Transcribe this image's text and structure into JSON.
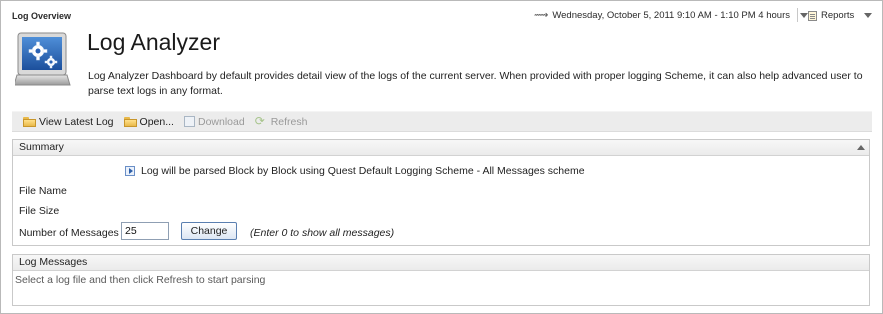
{
  "header": {
    "view_title": "Log Overview",
    "time_range": "Wednesday, October 5, 2011 9:10 AM - 1:10 PM 4 hours",
    "reports_label": "Reports"
  },
  "app": {
    "icon": "gear-monitor-icon",
    "title": "Log Analyzer",
    "description": "Log Analyzer Dashboard by default provides detail view of the logs of the current server. When provided with proper logging Scheme, it can also help advanced user to parse text logs in any format."
  },
  "toolbar": {
    "view_latest": "View Latest Log",
    "open": "Open...",
    "download": "Download",
    "refresh": "Refresh"
  },
  "summary": {
    "title": "Summary",
    "scheme_text": "Log will be parsed Block by Block using Quest Default Logging Scheme - All Messages scheme",
    "file_name_label": "File Name",
    "file_size_label": "File Size",
    "num_messages_label": "Number of Messages",
    "num_messages_value": "25",
    "change_button": "Change",
    "hint": "(Enter 0 to show all messages)"
  },
  "log_messages": {
    "title": "Log Messages",
    "empty_text": "Select a log file and then click Refresh to start parsing"
  }
}
